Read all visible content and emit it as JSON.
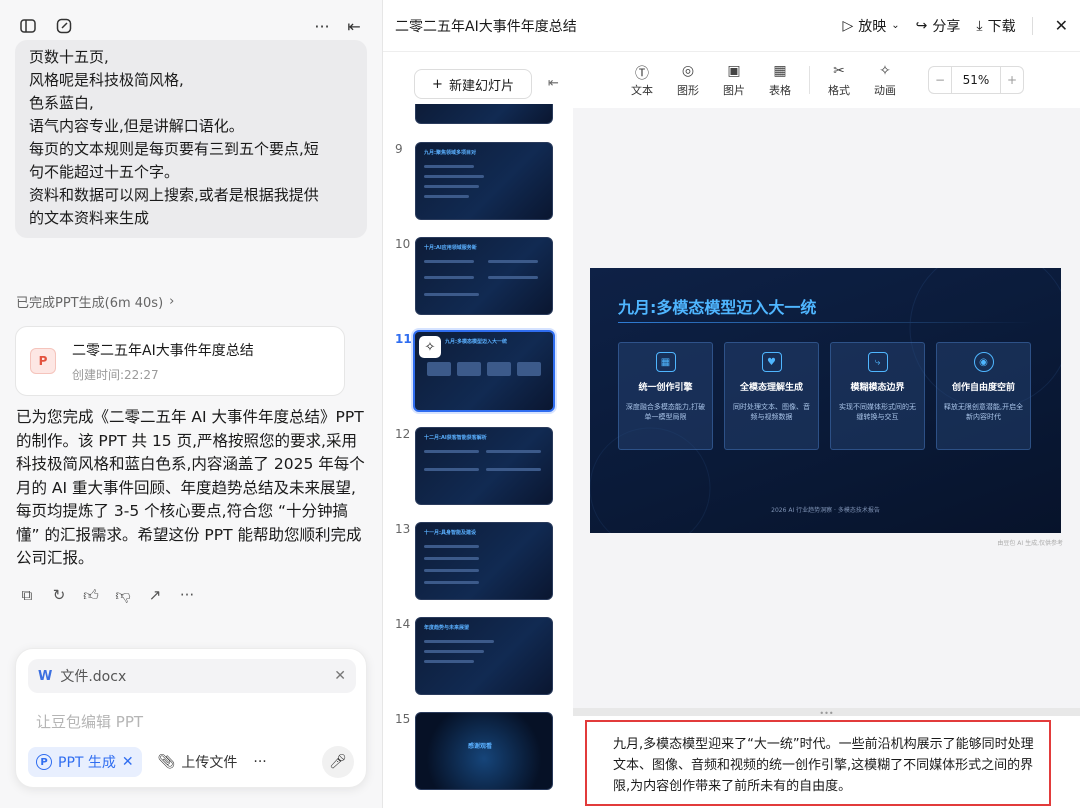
{
  "left": {
    "user_message_lines": [
      "页数十五页,",
      "风格呢是科技极简风格,",
      "色系蓝白,",
      "语气内容专业,但是讲解口语化。",
      "每页的文本规则是每页要有三到五个要点,短",
      "句不能超过十五个字。",
      "资料和数据可以网上搜索,或者是根据我提供",
      "的文本资料来生成"
    ],
    "done_status": "已完成PPT生成(6m 40s)",
    "file_card": {
      "name": "二零二五年AI大事件年度总结",
      "time": "创建时间:22:27",
      "badge": "P"
    },
    "answer": "已为您完成《二零二五年 AI 大事件年度总结》PPT 的制作。该 PPT 共 15 页,严格按照您的要求,采用科技极简风格和蓝白色系,内容涵盖了 2025 年每个月的 AI 重大事件回顾、年度趋势总结及未来展望,每页均提炼了 3-5 个核心要点,符合您 “十分钟搞懂” 的汇报需求。希望这份 PPT 能帮助您顺利完成公司汇报。",
    "composer": {
      "attachment": "文件.docx",
      "placeholder": "让豆包编辑 PPT",
      "chip_ppt": "PPT 生成",
      "upload": "上传文件",
      "more": "···"
    }
  },
  "right": {
    "title": "二零二五年AI大事件年度总结",
    "buttons": {
      "play": "放映",
      "share": "分享",
      "download": "下载"
    },
    "new_slide": "新建幻灯片",
    "tools": [
      "文本",
      "图形",
      "图片",
      "表格",
      "格式",
      "动画"
    ],
    "zoom": "51%",
    "thumb_numbers": [
      "9",
      "10",
      "11",
      "12",
      "13",
      "14",
      "15"
    ],
    "thumb_titles": [
      "九月:聚焦领域多项目对",
      "十月:AI应用领域服务新",
      "九月:多模态模型迈入大一统",
      "十二月:AI获客智能获客解析",
      "十一月:具身智能及建设",
      "年度趋势与未来展望",
      "感谢观看"
    ],
    "slide": {
      "title": "九月:多模态模型迈入大一统",
      "cards": [
        {
          "title": "统一创作引擎",
          "desc": "深度融合多模态能力,打破单一模型局限"
        },
        {
          "title": "全模态理解生成",
          "desc": "同时处理文本、图像、音频与视频数据"
        },
        {
          "title": "模糊模态边界",
          "desc": "实现不同媒体形式间的无缝转换与交互"
        },
        {
          "title": "创作自由度空前",
          "desc": "释放无限创意潜能,开启全新内容时代"
        }
      ],
      "footer": "2026 AI 行业趋势洞察 · 多模态技术报告",
      "ai_note": "由豆包 AI 生成,仅供参考"
    },
    "notes": "九月,多模态模型迎来了“大一统”时代。一些前沿机构展示了能够同时处理文本、图像、音频和视频的统一创作引擎,这模糊了不同媒体形式之间的界限,为内容创作带来了前所未有的自由度。"
  }
}
